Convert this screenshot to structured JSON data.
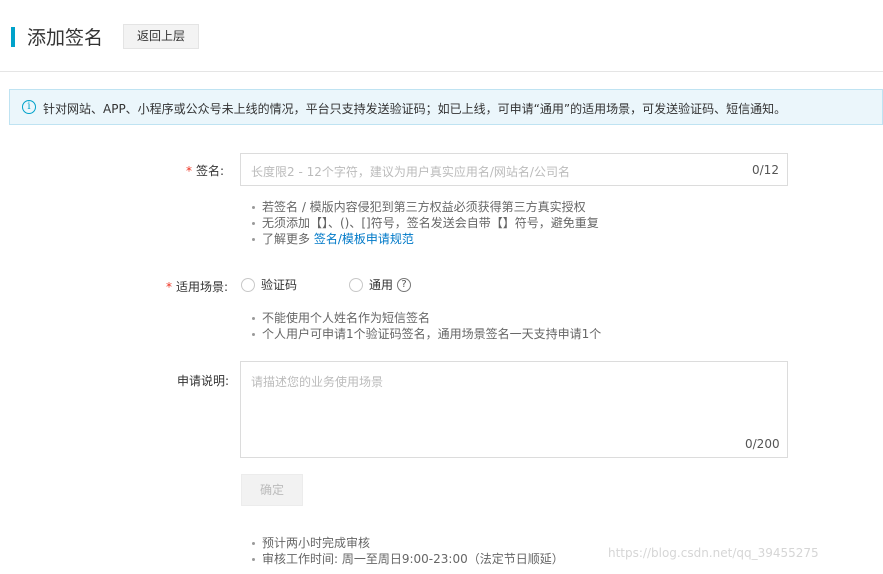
{
  "header": {
    "title": "添加签名",
    "back_label": "返回上层"
  },
  "notice": {
    "icon": "info-icon",
    "text": "针对网站、APP、小程序或公众号未上线的情况，平台只支持发送验证码；如已上线，可申请“通用”的适用场景，可发送验证码、短信通知。"
  },
  "form": {
    "signature": {
      "required_mark": "*",
      "label": "签名:",
      "placeholder": "长度限2 - 12个字符，建议为用户真实应用名/网站名/公司名",
      "value": "",
      "counter": "0/12",
      "tips": [
        "若签名 / 模版内容侵犯到第三方权益必须获得第三方真实授权",
        "无须添加【】、()、[]符号，签名发送会自带【】符号，避免重复"
      ],
      "more_prefix": "了解更多",
      "more_link": "签名/模板申请规范"
    },
    "scene": {
      "required_mark": "*",
      "label": "适用场景:",
      "options": [
        "验证码",
        "通用"
      ],
      "selected": "",
      "help_icon": "question-icon",
      "tips": [
        "不能使用个人姓名作为短信签名",
        "个人用户可申请1个验证码签名，通用场景签名一天支持申请1个"
      ]
    },
    "description": {
      "label": "申请说明:",
      "placeholder": "请描述您的业务使用场景",
      "value": "",
      "counter": "0/200"
    },
    "submit_label": "确定",
    "footer_tips": [
      "预计两小时完成审核",
      "审核工作时间: 周一至周日9:00-23:00（法定节日顺延）"
    ]
  },
  "watermark": "https://blog.csdn.net/qq_39455275",
  "colors": {
    "accent": "#00a2ca",
    "link": "#0079c8",
    "required": "#e32",
    "notice_bg": "#ebf6fb"
  }
}
